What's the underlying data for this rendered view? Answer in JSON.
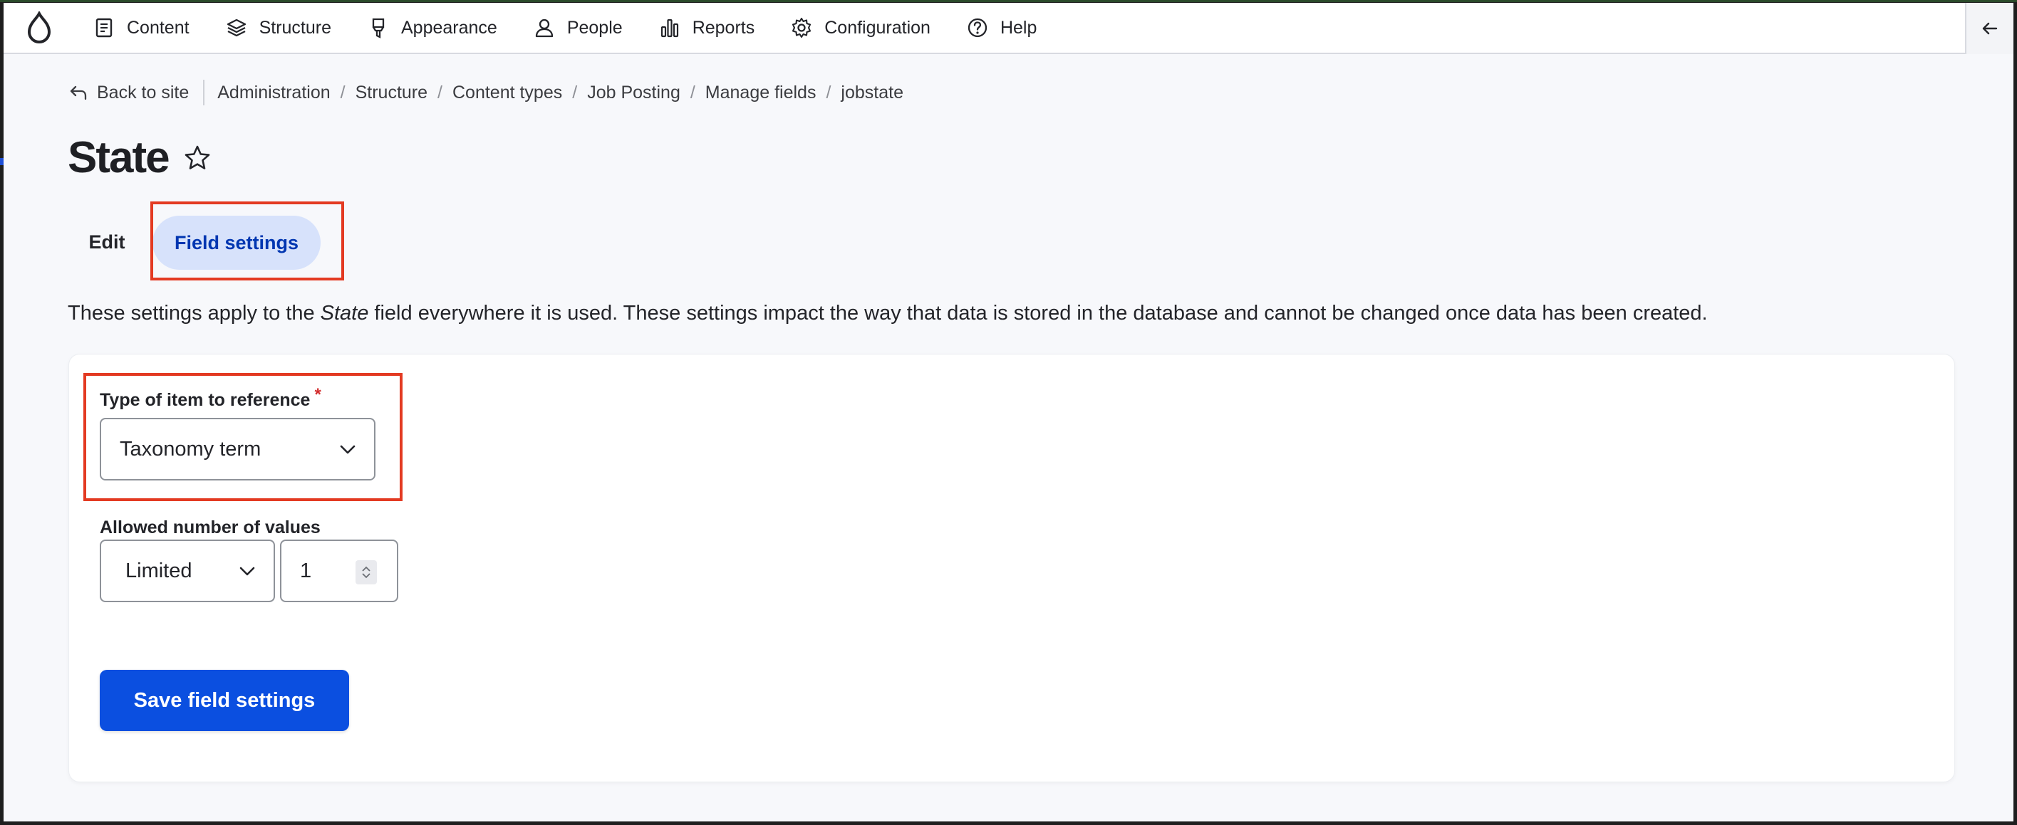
{
  "toolbar": {
    "items": [
      {
        "label": "Content",
        "icon": "document-icon"
      },
      {
        "label": "Structure",
        "icon": "layers-icon"
      },
      {
        "label": "Appearance",
        "icon": "brush-icon"
      },
      {
        "label": "People",
        "icon": "person-icon"
      },
      {
        "label": "Reports",
        "icon": "bar-chart-icon"
      },
      {
        "label": "Configuration",
        "icon": "gear-icon"
      },
      {
        "label": "Help",
        "icon": "question-icon"
      }
    ]
  },
  "breadcrumb": {
    "back_label": "Back to site",
    "items": [
      "Administration",
      "Structure",
      "Content types",
      "Job Posting",
      "Manage fields",
      "jobstate"
    ]
  },
  "page": {
    "title": "State"
  },
  "tabs": {
    "edit": "Edit",
    "field_settings": "Field settings"
  },
  "description": {
    "before": "These settings apply to the ",
    "field_name": "State",
    "after": " field everywhere it is used. These settings impact the way that data is stored in the database and cannot be changed once data has been created."
  },
  "form": {
    "type_label": "Type of item to reference",
    "required_mark": "*",
    "type_value": "Taxonomy term",
    "allowed_label": "Allowed number of values",
    "cardinality_value": "Limited",
    "number_value": "1",
    "save_label": "Save field settings"
  },
  "colors": {
    "accent": "#0b4fe0",
    "active_tab_bg": "#d7e2fb",
    "active_tab_text": "#0036b1",
    "highlight": "#e33a22",
    "required": "#d22d2d"
  }
}
